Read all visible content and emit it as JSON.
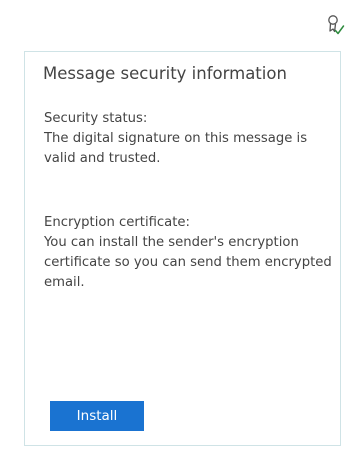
{
  "icons": {
    "signature": "signature-verified-icon"
  },
  "colors": {
    "accent": "#1a73d1",
    "text": "#444444",
    "card_border": "#cfe3e6",
    "verified_check": "#2e8b3e"
  },
  "card": {
    "title": "Message security information",
    "security_status": {
      "heading": "Security status:",
      "body": "The digital signature on this message is valid and trusted."
    },
    "encryption_certificate": {
      "heading": "Encryption certificate:",
      "body": "You can install the sender's encryption certificate so you can send them encrypted email."
    },
    "install_label": "Install"
  }
}
